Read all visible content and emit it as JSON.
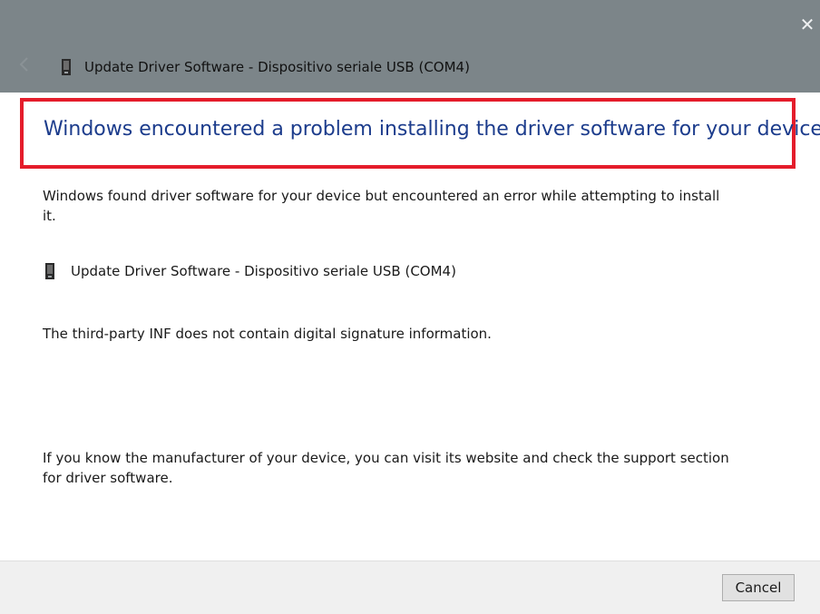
{
  "window": {
    "title": "Update Driver Software - Dispositivo seriale USB (COM4)",
    "close_glyph": "✕",
    "back_icon": "back-arrow-icon",
    "device_icon": "usb-device-icon"
  },
  "content": {
    "headline": "Windows encountered a problem installing the driver software for your device",
    "description": "Windows found driver software for your device but encountered an error while attempting to install it.",
    "device_name": "Update Driver Software - Dispositivo seriale USB (COM4)",
    "error_message": "The third-party INF does not contain digital signature information.",
    "support_hint": "If you know the manufacturer of your device, you can visit its website and check the support section for driver software."
  },
  "footer": {
    "cancel_label": "Cancel"
  },
  "colors": {
    "titlebar": "#7c8589",
    "headline": "#1c3c8c",
    "highlight_border": "#e41d2b",
    "footer": "#f0f0f0"
  }
}
